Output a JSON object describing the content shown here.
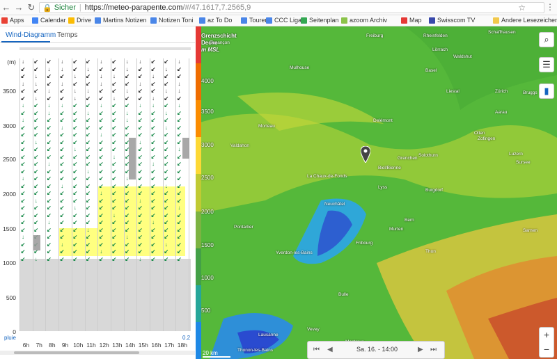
{
  "browser": {
    "secure": "Sicher",
    "url_host": "https://meteo-parapente.com",
    "url_path": "/#/47.1617,7.2565,9"
  },
  "bookmarks": [
    {
      "label": "Apps",
      "color": "#e94235"
    },
    {
      "label": "Calendar",
      "color": "#4285f4"
    },
    {
      "label": "Drive",
      "color": "#fbbc04"
    },
    {
      "label": "Martins Notizen",
      "color": "#4a86e8"
    },
    {
      "label": "Notizen Toni",
      "color": "#4a86e8"
    },
    {
      "label": "az To Do",
      "color": "#4a86e8"
    },
    {
      "label": "Touren",
      "color": "#4a86e8"
    },
    {
      "label": "CCC Liga",
      "color": "#4a86e8"
    },
    {
      "label": "Seitenplan",
      "color": "#34a853"
    },
    {
      "label": "azoom Archiv",
      "color": "#8bc34a"
    },
    {
      "label": "Map",
      "color": "#e53935"
    },
    {
      "label": "Swisscom TV",
      "color": "#3949ab"
    },
    {
      "label": "Andere Lesezeichen",
      "color": "#f2c94c"
    }
  ],
  "tabs": {
    "wind": "Wind-Diagramm",
    "temps": "Temps"
  },
  "altitude_unit": "(m)",
  "altitudes": [
    "3500",
    "3000",
    "2500",
    "2000",
    "1500",
    "1000",
    "500",
    "0"
  ],
  "hours": [
    "6h",
    "7h",
    "8h",
    "9h",
    "10h",
    "11h",
    "12h",
    "13h",
    "14h",
    "15h",
    "16h",
    "17h",
    "18h"
  ],
  "pluie_label": "pluie",
  "pluie_value": "0.2",
  "map": {
    "legend_title": "Grenzschicht Decke",
    "legend_sub": "m MSL",
    "legend_ticks": [
      "4000",
      "3500",
      "3000",
      "2500",
      "2000",
      "1500",
      "1000",
      "500"
    ],
    "places": [
      "Mulhouse",
      "Freiburg",
      "Basel",
      "Liestal",
      "Delémont",
      "Solothurn",
      "Grenchen",
      "Biel/Bienne",
      "Neuchâtel",
      "La Chaux-de-Fonds",
      "Pontarlier",
      "Yverdon-les-Bains",
      "Lausanne",
      "Fribourg",
      "Bern",
      "Thun",
      "Aarau",
      "Olten",
      "Burgdorf",
      "Lyss",
      "Murten",
      "Vevey",
      "Montreux",
      "Thonon-les-Bains",
      "Bulle",
      "Schaffhausen",
      "Zürich",
      "Luzern",
      "Sarnen",
      "Bruggs",
      "Zofingen",
      "Sursee",
      "Waldshut",
      "Rheinfelden",
      "Lörrach",
      "Morteau",
      "Valdahon",
      "Besançon"
    ],
    "player_date": "Sa. 16. - 14:00",
    "scale": "20 km"
  }
}
